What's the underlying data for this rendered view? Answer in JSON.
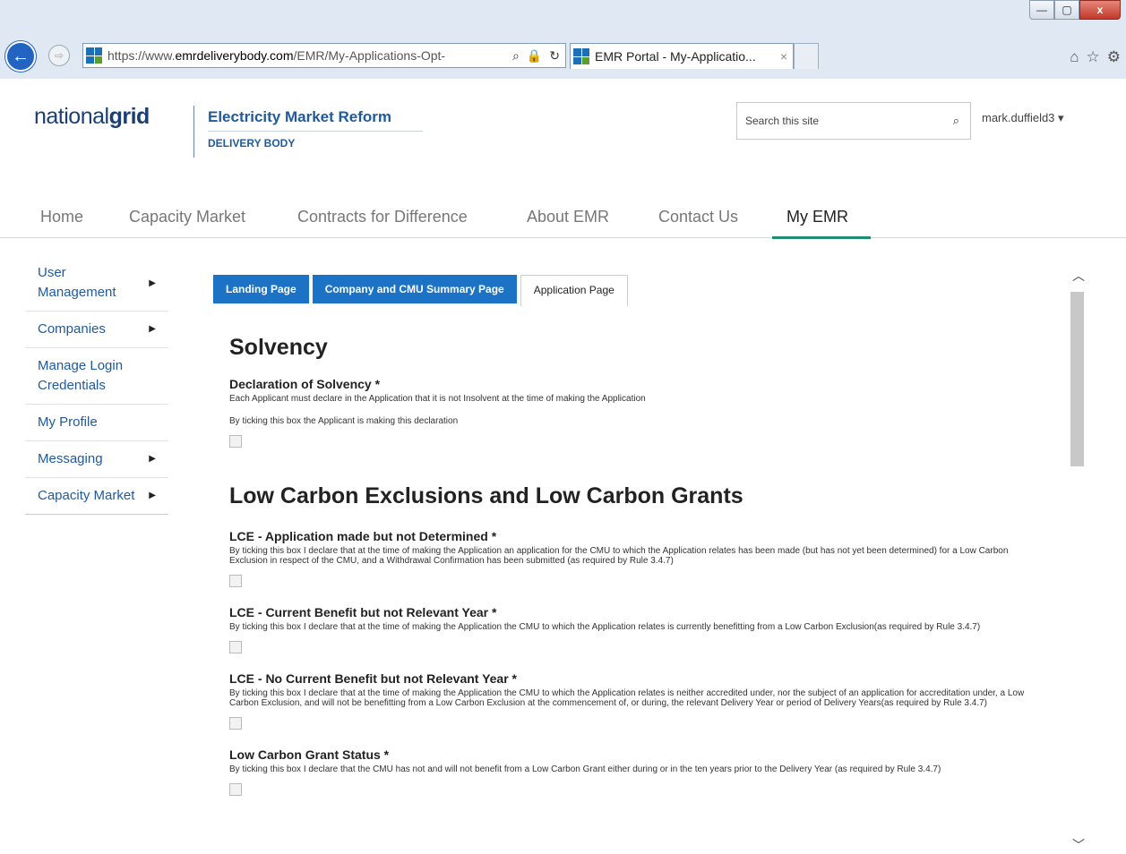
{
  "browser": {
    "url_prefix": "https://www.",
    "url_domain": "emrdeliverybody.com",
    "url_path": "/EMR/My-Applications-Opt-",
    "tab_title": "EMR Portal - My-Applicatio...",
    "tab_close": "×",
    "addr_search_icon": "⌕",
    "addr_lock_icon": "🔒",
    "addr_refresh_icon": "↻",
    "back_icon": "←",
    "forward_icon": "⇨",
    "home_icon": "⌂",
    "favorites_icon": "☆",
    "tools_icon": "⚙",
    "minimize": "—",
    "maximize": "▢",
    "close": "x"
  },
  "header": {
    "logo_light": "national",
    "logo_bold": "grid",
    "title": "Electricity Market Reform",
    "subtitle": "DELIVERY BODY",
    "search_placeholder": "Search this site",
    "search_icon": "⌕",
    "user": "mark.duffield3 ▾"
  },
  "topnav": [
    "Home",
    "Capacity Market",
    "Contracts for Difference",
    "About EMR",
    "Contact Us",
    "My EMR"
  ],
  "sidebar": [
    {
      "label": "User Management",
      "arrow": "▶"
    },
    {
      "label": "Companies",
      "arrow": "▶"
    },
    {
      "label": "Manage Login Credentials",
      "arrow": ""
    },
    {
      "label": "My Profile",
      "arrow": ""
    },
    {
      "label": "Messaging",
      "arrow": "▶"
    },
    {
      "label": "Capacity Market",
      "arrow": "▶"
    }
  ],
  "page_tabs": [
    "Landing Page",
    "Company and CMU Summary Page",
    "Application Page"
  ],
  "solvency": {
    "heading": "Solvency",
    "question": "Declaration of Solvency *",
    "desc": "Each Applicant must declare in the Application that it is not Insolvent at the time of making the Application",
    "desc2": "By ticking this box the Applicant is making this declaration"
  },
  "lce": {
    "heading": "Low Carbon Exclusions and Low Carbon Grants",
    "items": [
      {
        "question": "LCE - Application made but not Determined *",
        "desc": "By ticking this box I declare that at the time of making the Application an application for the CMU to which the Application relates has been made (but has not yet been determined) for a Low Carbon Exclusion in respect of the CMU, and a Withdrawal Confirmation has been submitted (as required by Rule 3.4.7)"
      },
      {
        "question": "LCE - Current Benefit but not Relevant Year *",
        "desc": "By ticking this box I declare that at the time of making the Application the CMU to which the Application relates is currently benefitting from a Low Carbon Exclusion(as required by Rule 3.4.7)"
      },
      {
        "question": "LCE - No Current Benefit but not Relevant Year *",
        "desc": "By ticking this box I declare that at the time of making the Application the CMU to which the Application relates is neither accredited under, nor the subject of an application for accreditation under, a Low Carbon Exclusion, and will not be benefitting from a Low Carbon Exclusion at the commencement of, or during, the relevant Delivery Year or period of Delivery Years(as required by Rule 3.4.7)"
      },
      {
        "question": "Low Carbon Grant Status *",
        "desc": "By ticking this box I declare that the CMU has not and will not benefit from a Low Carbon Grant either during or in the ten years prior to the Delivery Year (as required by Rule 3.4.7)"
      }
    ]
  },
  "scroll": {
    "up": "︿",
    "down": "﹀"
  }
}
